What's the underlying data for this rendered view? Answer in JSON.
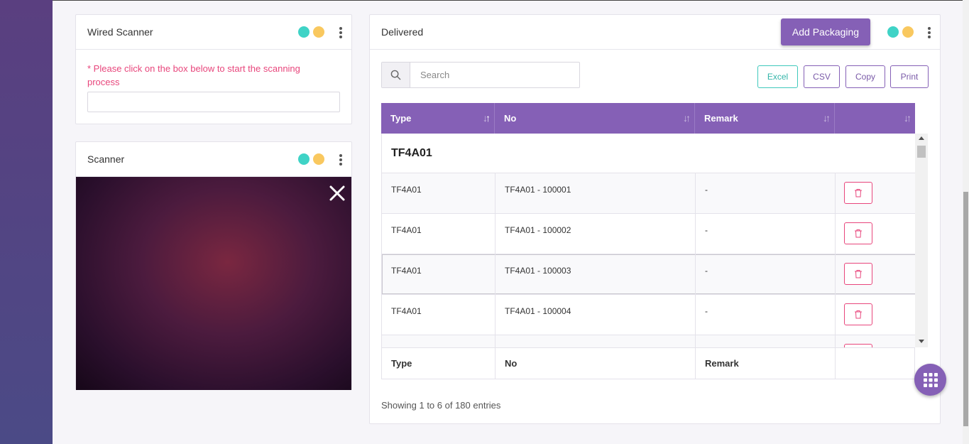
{
  "wired_scanner": {
    "title": "Wired Scanner",
    "hint": "* Please click on the box below to start the scanning process",
    "input_value": ""
  },
  "scanner": {
    "title": "Scanner"
  },
  "delivered": {
    "title": "Delivered",
    "add_button": "Add Packaging",
    "search_placeholder": "Search",
    "export_buttons": {
      "excel": "Excel",
      "csv": "CSV",
      "copy": "Copy",
      "print": "Print"
    },
    "columns": [
      "Type",
      "No",
      "Remark",
      ""
    ],
    "group_label": "TF4A01",
    "rows": [
      {
        "type": "TF4A01",
        "no": "TF4A01 - 100001",
        "remark": "-"
      },
      {
        "type": "TF4A01",
        "no": "TF4A01 - 100002",
        "remark": "-"
      },
      {
        "type": "TF4A01",
        "no": "TF4A01 - 100003",
        "remark": "-"
      },
      {
        "type": "TF4A01",
        "no": "TF4A01 - 100004",
        "remark": "-"
      }
    ],
    "footer_columns": [
      "Type",
      "No",
      "Remark",
      ""
    ],
    "info": "Showing 1 to 6 of 180 entries"
  },
  "colors": {
    "accent": "#8560b6",
    "teal": "#3fd3c6",
    "yellow": "#f9c85f",
    "danger": "#e8467c"
  },
  "icons": {
    "status_dots": [
      "teal-dot",
      "yellow-dot"
    ],
    "menu": "kebab-icon",
    "search": "search-icon",
    "close": "close-icon",
    "delete": "trash-icon",
    "fab": "grid-icon"
  }
}
